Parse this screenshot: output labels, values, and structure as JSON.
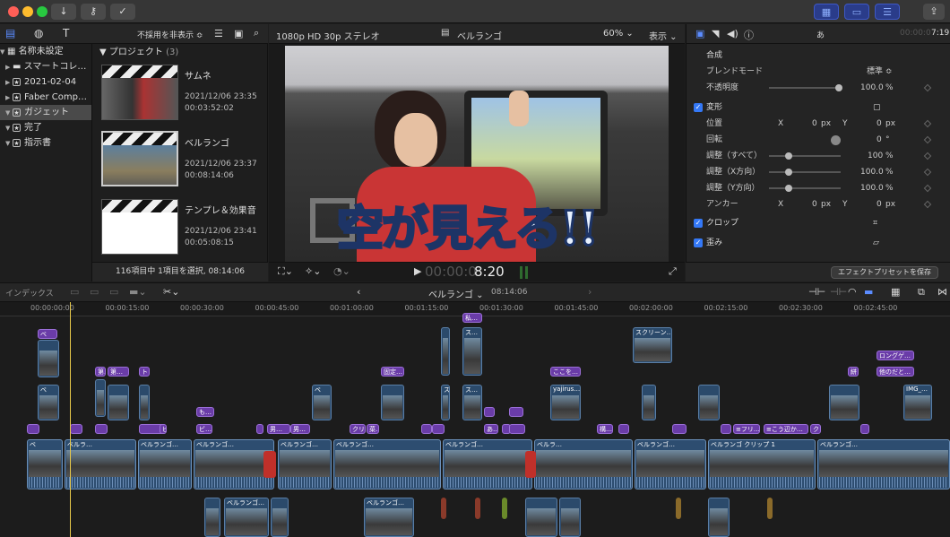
{
  "window": {
    "colors": {
      "close": "#ff5f57",
      "min": "#febc2e",
      "max": "#28c840",
      "accent": "#3478f6"
    },
    "toolbar_left": [
      "down-arrow-icon",
      "key-icon",
      "checkmark-icon"
    ],
    "toolbar_right": [
      "grid-icon",
      "video-icon",
      "sliders-icon",
      "share-icon"
    ]
  },
  "sidebar": {
    "items": [
      {
        "label": "名称未設定",
        "icon": "library-icon",
        "indent": 0,
        "selected": false
      },
      {
        "label": "スマートコレ…",
        "icon": "folder-icon",
        "indent": 1,
        "selected": false
      },
      {
        "label": "2021-02-04",
        "icon": "star-icon",
        "indent": 1,
        "selected": false
      },
      {
        "label": "Faber Comp…",
        "icon": "star-icon",
        "indent": 1,
        "selected": false
      },
      {
        "label": "ガジェット",
        "icon": "star-icon",
        "indent": 1,
        "selected": true
      },
      {
        "label": "完了",
        "icon": "star-icon",
        "indent": 1,
        "selected": false
      },
      {
        "label": "指示書",
        "icon": "star-icon",
        "indent": 1,
        "selected": false
      }
    ]
  },
  "browser": {
    "filter": "不採用を非表示 ≎",
    "section": "プロジェクト",
    "count": "(3)",
    "clips": [
      {
        "name": "サムネ",
        "date": "2021/12/06 23:35",
        "duration": "00:03:52:02"
      },
      {
        "name": "ベルランゴ",
        "date": "2021/12/06 23:37",
        "duration": "00:08:14:06"
      },
      {
        "name": "テンプレ＆効果音",
        "date": "2021/12/06 23:41",
        "duration": "00:05:08:15"
      }
    ],
    "status": "116項目中 1項目を選択, 08:14:06"
  },
  "viewer": {
    "format": "1080p HD 30p ステレオ",
    "project": "ベルランゴ",
    "zoom": "60%",
    "view": "表示",
    "caption": "空が見える!!",
    "timecode_dim": "00:00:0",
    "timecode_main": "8:20"
  },
  "inspector": {
    "a_label": "あ",
    "duration_dim": "00:00:0",
    "duration_main": "7:19",
    "composite": "合成",
    "blend_mode_label": "ブレンドモード",
    "blend_mode": "標準 ≎",
    "opacity_label": "不透明度",
    "opacity": "100.0",
    "pct": "%",
    "opacity_fraction": 1.0,
    "transform": "変形",
    "position": "位置",
    "x": "X",
    "y": "Y",
    "px": "px",
    "pos_x": "0",
    "pos_y": "0",
    "rotation": "回転",
    "rotation_val": "0",
    "deg": "°",
    "scale_all": "調整（すべて）",
    "scale_all_val": "100",
    "scale_x": "調整（X方向）",
    "scale_x_val": "100.0",
    "scale_y": "調整（Y方向）",
    "scale_y_val": "100.0",
    "anchor": "アンカー",
    "anchor_x": "0",
    "anchor_y": "0",
    "crop": "クロップ",
    "distort": "歪み",
    "save_preset": "エフェクトプリセットを保存"
  },
  "timeline": {
    "index": "インデックス",
    "project": "ベルランゴ",
    "duration": "08:14:06",
    "ruler": [
      "00:00:00:00",
      "00:00:15:00",
      "00:00:30:00",
      "00:00:45:00",
      "00:01:00:00",
      "00:01:15:00",
      "00:01:30:00",
      "00:01:45:00",
      "00:02:00:00",
      "00:02:15:00",
      "00:02:30:00",
      "00:02:45:00"
    ],
    "title_labels": [
      "ベ",
      "第…",
      "ト",
      "も…",
      "固定…",
      "ここを…",
      "ロングゲ…",
      "他のだと…",
      "私…",
      "ビ…",
      "男…",
      "クリ…",
      "菜…",
      "あ…",
      "構…",
      "≡フリ…",
      "≡こう辺か…",
      "ク",
      "絣"
    ],
    "connected_labels": [
      "ベ",
      "ベ",
      "ス…",
      "ス…",
      "yajirus…",
      "スクリーン…",
      "IMG_…",
      "ベルランゴ…",
      "ベルランゴ…",
      "ベルランゴ…"
    ],
    "primary_labels": [
      "ベ",
      "ベルラ…",
      "ベルランゴ…",
      "ベルランゴ…",
      "ベルランゴ…",
      "ベルランゴ…",
      "ベルランゴ…",
      "ベルランゴ クリップ 1",
      "ベルランゴ…"
    ]
  }
}
